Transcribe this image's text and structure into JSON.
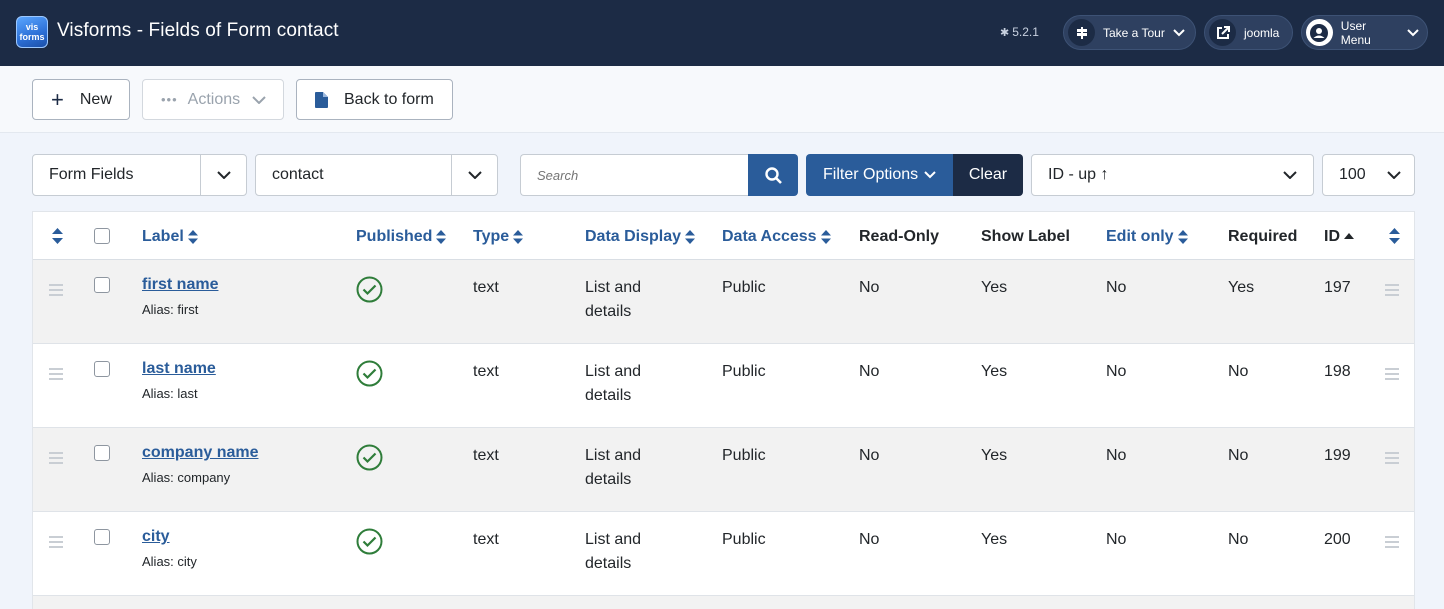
{
  "header": {
    "logo_text_top": "vis",
    "logo_text_bottom": "forms",
    "title": "Visforms - Fields of Form contact",
    "version": "5.2.1",
    "tour_label": "Take a Tour",
    "site_label": "joomla",
    "user_menu_label": "User Menu"
  },
  "toolbar": {
    "new_label": "New",
    "actions_label": "Actions",
    "back_label": "Back to form"
  },
  "filters": {
    "form_fields_select": "Form Fields",
    "form_select": "contact",
    "search_placeholder": "Search",
    "filter_options_label": "Filter Options",
    "clear_label": "Clear",
    "ordering_select": "ID - up ↑",
    "limit_select": "100"
  },
  "table": {
    "columns": {
      "label": "Label",
      "published": "Published",
      "type": "Type",
      "data_display": "Data Display",
      "data_access": "Data Access",
      "read_only": "Read-Only",
      "show_label": "Show Label",
      "edit_only": "Edit only",
      "required": "Required",
      "id": "ID"
    },
    "rows": [
      {
        "label": "first name",
        "alias": "Alias: first",
        "type": "text",
        "display_1": "List and",
        "display_2": "details",
        "access": "Public",
        "read_only": "No",
        "show_label": "Yes",
        "edit_only": "No",
        "required": "Yes",
        "id": "197"
      },
      {
        "label": "last name",
        "alias": "Alias: last",
        "type": "text",
        "display_1": "List and",
        "display_2": "details",
        "access": "Public",
        "read_only": "No",
        "show_label": "Yes",
        "edit_only": "No",
        "required": "No",
        "id": "198"
      },
      {
        "label": "company name",
        "alias": "Alias: company",
        "type": "text",
        "display_1": "List and",
        "display_2": "details",
        "access": "Public",
        "read_only": "No",
        "show_label": "Yes",
        "edit_only": "No",
        "required": "No",
        "id": "199"
      },
      {
        "label": "city",
        "alias": "Alias: city",
        "type": "text",
        "display_1": "List and",
        "display_2": "details",
        "access": "Public",
        "read_only": "No",
        "show_label": "Yes",
        "edit_only": "No",
        "required": "No",
        "id": "200"
      }
    ]
  },
  "colors": {
    "header_bg": "#1c2b45",
    "primary": "#2a5c9a",
    "published_green": "#2f7d3a"
  }
}
